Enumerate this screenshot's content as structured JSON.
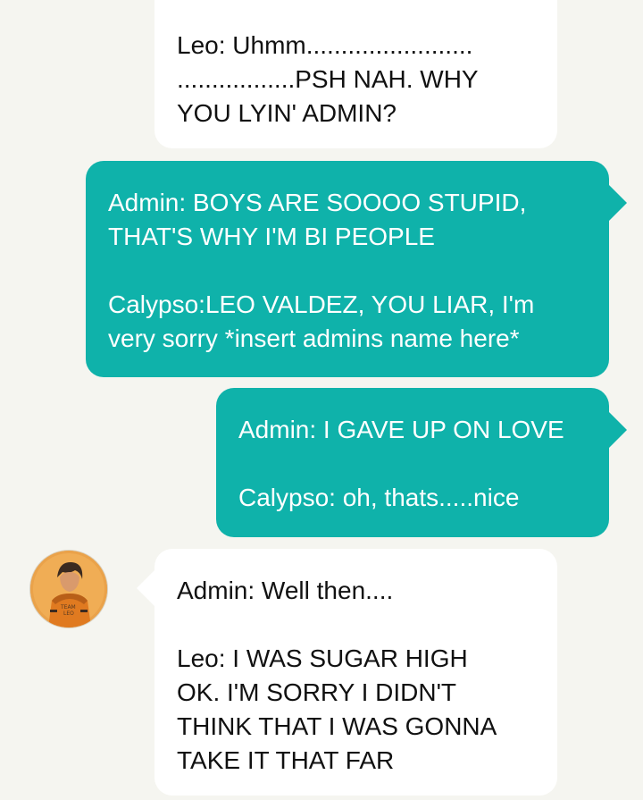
{
  "messages": [
    {
      "direction": "incoming",
      "paragraphs": [
        "Leo: Uhmm........................\n.................PSH NAH. WHY\nYOU LYIN' ADMIN?"
      ]
    },
    {
      "direction": "outgoing",
      "paragraphs": [
        "Admin: BOYS ARE SOOOO STUPID,\nTHAT'S WHY I'M BI PEOPLE",
        "Calypso:LEO VALDEZ, YOU LIAR, I'm\nvery sorry *insert admins name here*"
      ]
    },
    {
      "direction": "outgoing",
      "paragraphs": [
        "Admin: I GAVE UP ON LOVE",
        "Calypso: oh, thats.....nice"
      ]
    },
    {
      "direction": "incoming",
      "paragraphs": [
        "Admin: Well then....",
        "Leo: I WAS SUGAR HIGH\nOK. I'M SORRY I DIDN'T\nTHINK THAT I WAS GONNA\nTAKE IT THAT FAR"
      ]
    }
  ],
  "avatar": {
    "icon": "avatar-icon",
    "shirt_text": "TEAM LEO"
  },
  "colors": {
    "background": "#f5f5f0",
    "incoming_bubble": "#ffffff",
    "outgoing_bubble": "#0fb2aa",
    "incoming_text": "#111111",
    "outgoing_text": "#ffffff",
    "avatar_background": "#eaa24a"
  }
}
